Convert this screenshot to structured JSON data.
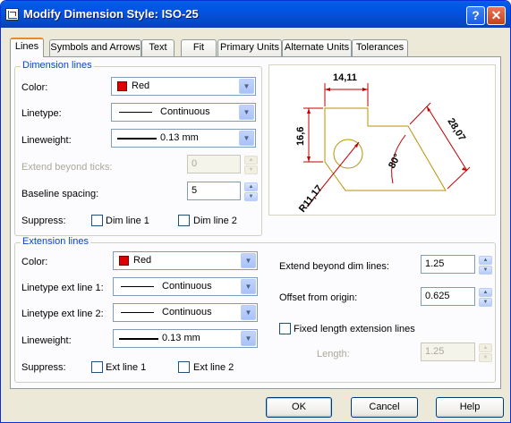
{
  "title": "Modify Dimension Style: ISO-25",
  "title_buttons": {
    "help": "?",
    "close": "✕"
  },
  "tabs": [
    "Lines",
    "Symbols and Arrows",
    "Text",
    "Fit",
    "Primary Units",
    "Alternate Units",
    "Tolerances"
  ],
  "active_tab": "Lines",
  "dimension_lines": {
    "title": "Dimension lines",
    "color_label": "Color:",
    "color_value": "Red",
    "linetype_label": "Linetype:",
    "linetype_value": "Continuous",
    "lineweight_label": "Lineweight:",
    "lineweight_value": "0.13 mm",
    "extend_label": "Extend beyond ticks:",
    "extend_value": "0",
    "baseline_label": "Baseline spacing:",
    "baseline_value": "5",
    "suppress_label": "Suppress:",
    "suppress_1": "Dim line 1",
    "suppress_2": "Dim line 2"
  },
  "extension_lines": {
    "title": "Extension lines",
    "color_label": "Color:",
    "color_value": "Red",
    "lt1_label": "Linetype ext line 1:",
    "lt1_value": "Continuous",
    "lt2_label": "Linetype ext line 2:",
    "lt2_value": "Continuous",
    "lineweight_label": "Lineweight:",
    "lineweight_value": "0.13 mm",
    "suppress_label": "Suppress:",
    "suppress_1": "Ext line 1",
    "suppress_2": "Ext line 2",
    "extend_label": "Extend beyond dim lines:",
    "extend_value": "1.25",
    "offset_label": "Offset from origin:",
    "offset_value": "0.625",
    "fixed_label": "Fixed length extension lines",
    "length_label": "Length:",
    "length_value": "1.25"
  },
  "preview": {
    "dim_top": "14,11",
    "dim_left": "16,6",
    "dim_right": "28,07",
    "dim_angle": "80°",
    "dim_radius": "R11,17"
  },
  "colors": {
    "accent_red": "#e00000",
    "preview_line": "#c00000",
    "part_outline": "#b89300",
    "group_title": "#0046d5"
  },
  "buttons": {
    "ok": "OK",
    "cancel": "Cancel",
    "help": "Help"
  }
}
